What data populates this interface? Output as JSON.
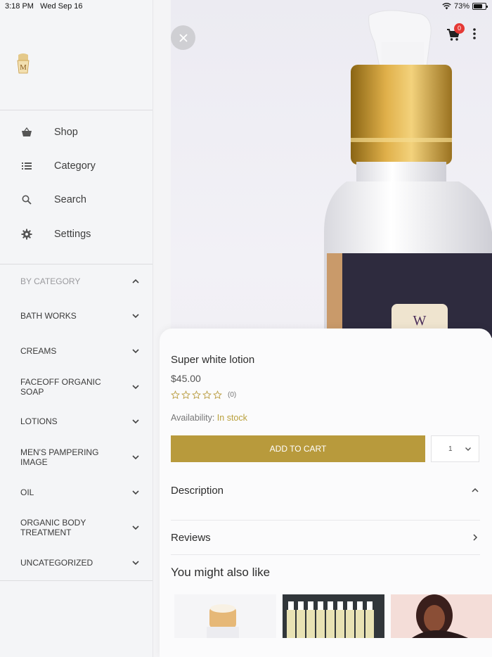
{
  "status": {
    "time": "3:18 PM",
    "date": "Wed Sep 16",
    "battery": "73%",
    "battery_level": 0.73
  },
  "drawer": {
    "menu": [
      {
        "label": "Shop",
        "icon": "basket-icon"
      },
      {
        "label": "Category",
        "icon": "list-icon"
      },
      {
        "label": "Search",
        "icon": "search-icon"
      },
      {
        "label": "Settings",
        "icon": "gear-icon"
      }
    ],
    "category_header": "BY CATEGORY",
    "categories": [
      "BATH WORKS",
      "CREAMS",
      "FACEOFF ORGANIC SOAP",
      "LOTIONS",
      "MEN'S PAMPERING IMAGE",
      "OIL",
      "ORGANIC BODY TREATMENT",
      "UNCATEGORIZED"
    ]
  },
  "header": {
    "cart_count": "0"
  },
  "product": {
    "name": "Super white lotion",
    "price": "$45.00",
    "rating_count": "(0)",
    "availability_label": "Availability:",
    "availability_value": "In stock",
    "add_to_cart": "ADD TO CART",
    "quantity": "1"
  },
  "sections": {
    "description": "Description",
    "reviews": "Reviews"
  },
  "related": {
    "title": "You might also like"
  },
  "colors": {
    "accent": "#b89a3c",
    "badge": "#e53935"
  }
}
